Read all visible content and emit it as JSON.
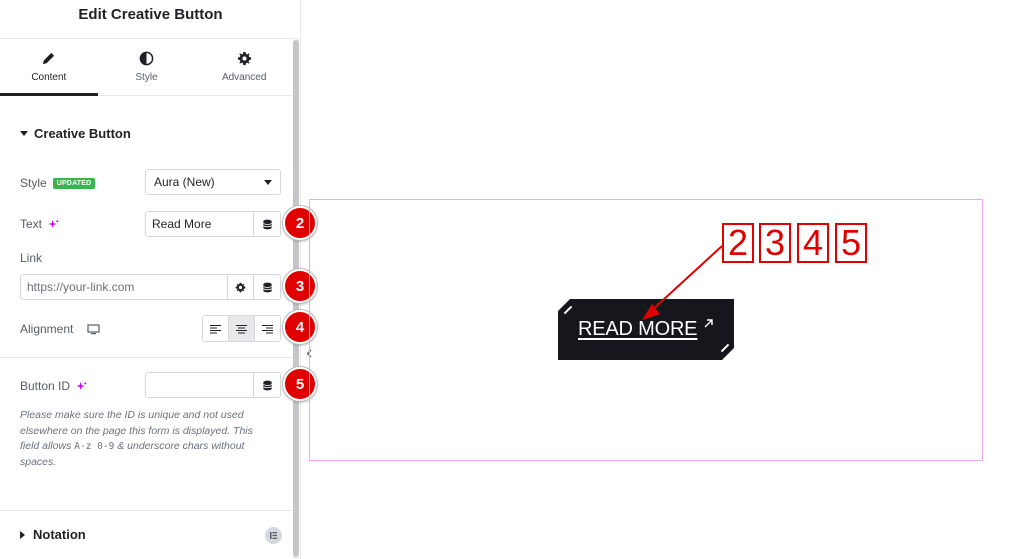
{
  "panel": {
    "title": "Edit Creative Button",
    "tabs": [
      {
        "label": "Content",
        "icon": "pencil-icon",
        "active": true
      },
      {
        "label": "Style",
        "icon": "half-circle-icon",
        "active": false
      },
      {
        "label": "Advanced",
        "icon": "gear-icon",
        "active": false
      }
    ]
  },
  "section": {
    "title": "Creative Button",
    "style": {
      "label": "Style",
      "badge": "UPDATED",
      "value": "Aura (New)"
    },
    "text": {
      "label": "Text",
      "value": "Read More"
    },
    "link": {
      "label": "Link",
      "placeholder": "https://your-link.com"
    },
    "alignment": {
      "label": "Alignment",
      "options": [
        "left",
        "center",
        "right"
      ],
      "selected": "center"
    },
    "button_id": {
      "label": "Button ID",
      "value": ""
    },
    "help_text_part1": "Please make sure the ID is unique and not used elsewhere on the page this form is displayed. This field allows ",
    "help_text_code": "A-z 0-9",
    "help_text_part2": " & underscore chars without spaces."
  },
  "notation": {
    "title": "Notation"
  },
  "markers": [
    "2",
    "3",
    "4",
    "5"
  ],
  "canvas": {
    "button_label": "READ MORE",
    "annotation_numbers": [
      "2",
      "3",
      "4",
      "5"
    ]
  },
  "colors": {
    "marker_red": "#e00000",
    "button_bg": "#15171c",
    "frame_border": "#f0a7f0",
    "badge_green": "#39b54a"
  }
}
